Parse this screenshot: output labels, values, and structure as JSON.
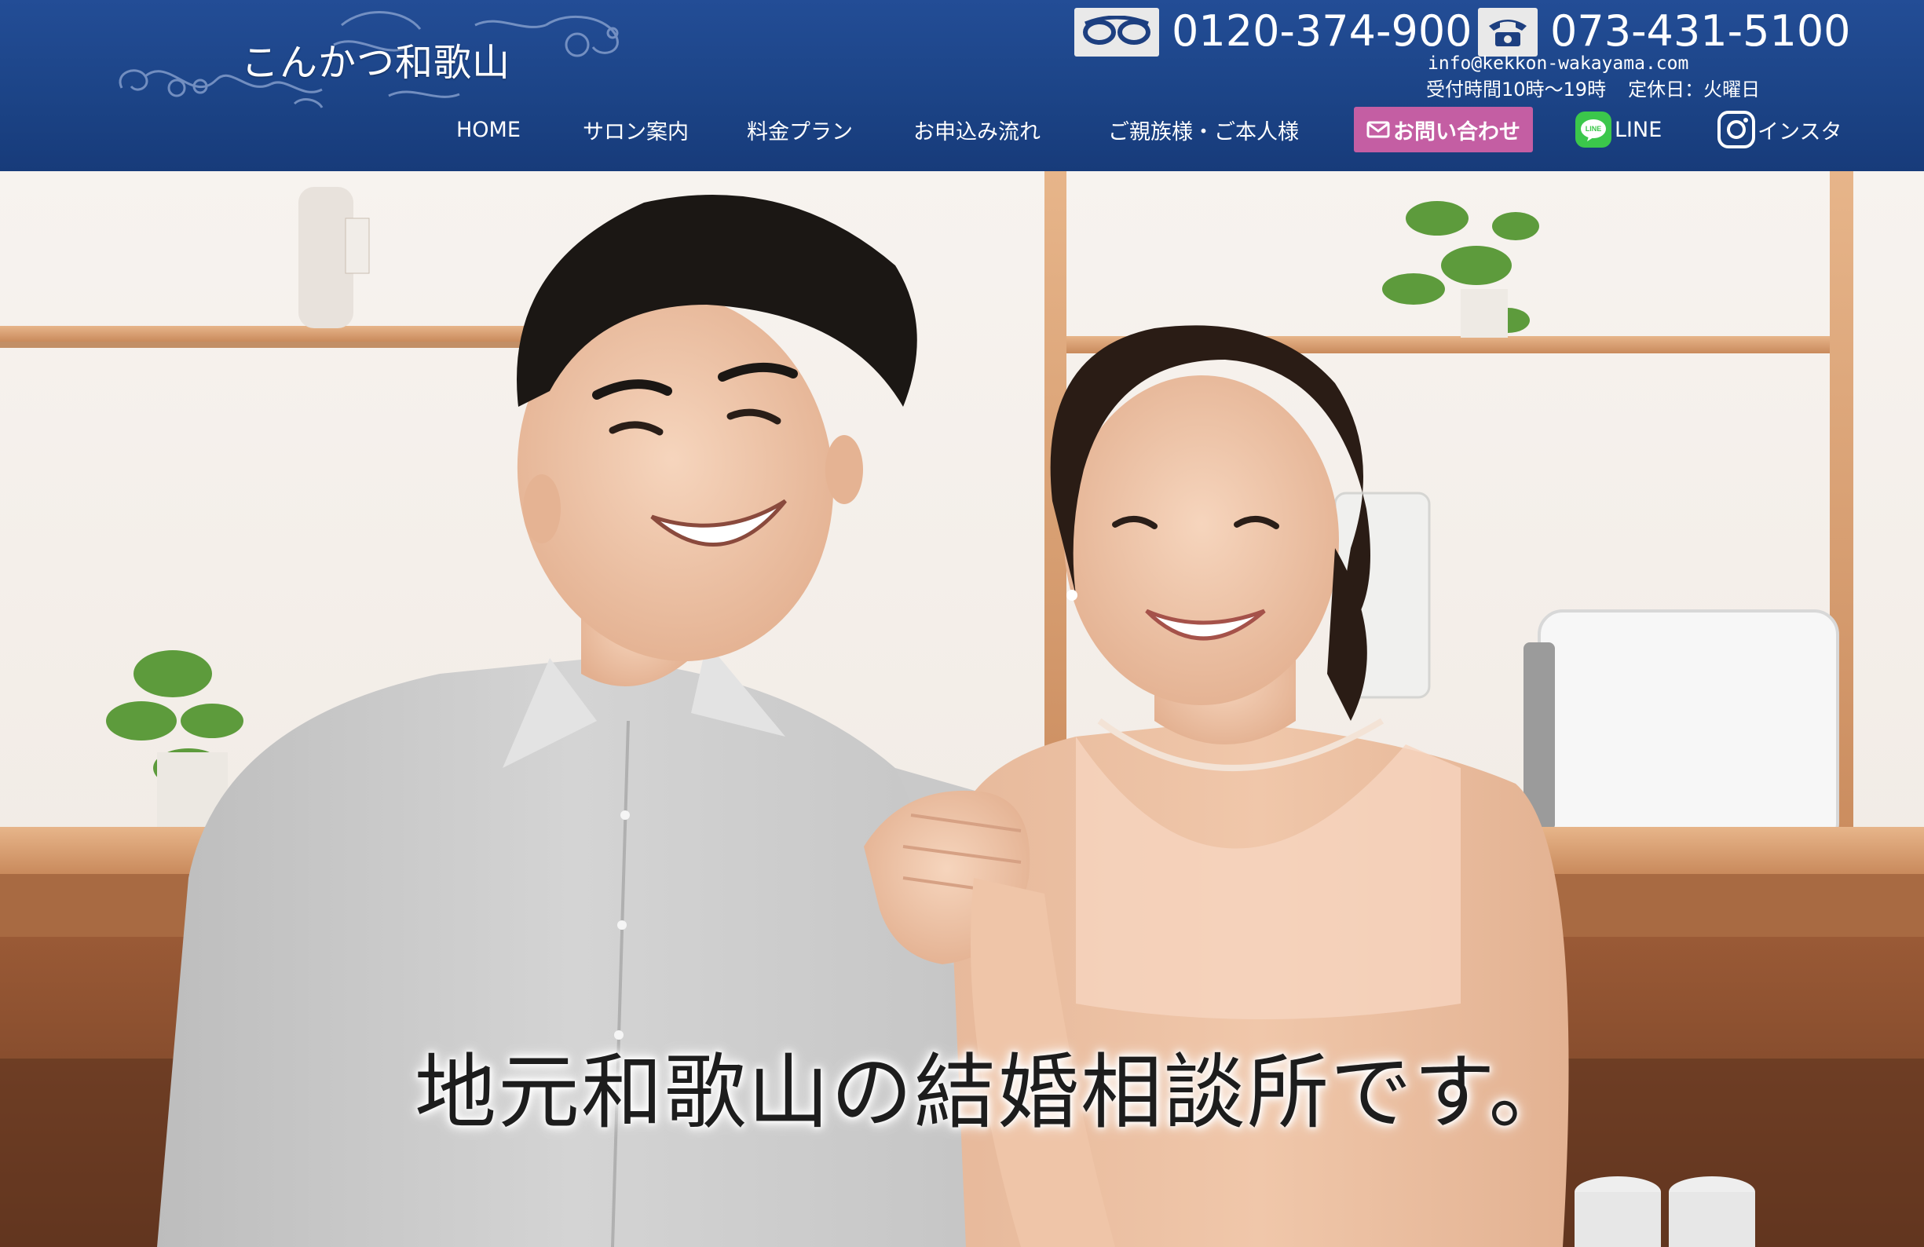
{
  "header": {
    "logo_text": "こんかつ和歌山",
    "contact": {
      "freedial_icon": "freedial-icon",
      "freedial_number": "0120-374-900",
      "tel_icon": "telephone-icon",
      "tel_number": "073-431-5100",
      "email": "info@kekkon-wakayama.com",
      "hours": "受付時間10時〜19時",
      "closed_day": "定休日：火曜日"
    }
  },
  "nav": {
    "items": [
      {
        "label": "HOME"
      },
      {
        "label": "サロン案内"
      },
      {
        "label": "料金プラン"
      },
      {
        "label": "お申込み流れ"
      },
      {
        "label": "ご親族様・ご本人様"
      },
      {
        "label": "お問い合わせ",
        "icon": "mail-icon"
      },
      {
        "label": "LINE",
        "icon": "line-icon"
      },
      {
        "label": "インスタ",
        "icon": "instagram-icon"
      }
    ]
  },
  "hero": {
    "caption": "地元和歌山の結婚相談所です。"
  },
  "colors": {
    "header_bg": "#1c4487",
    "contact_button": "#c45ea3",
    "line_green": "#3bc74b",
    "text_white": "#ffffff"
  }
}
